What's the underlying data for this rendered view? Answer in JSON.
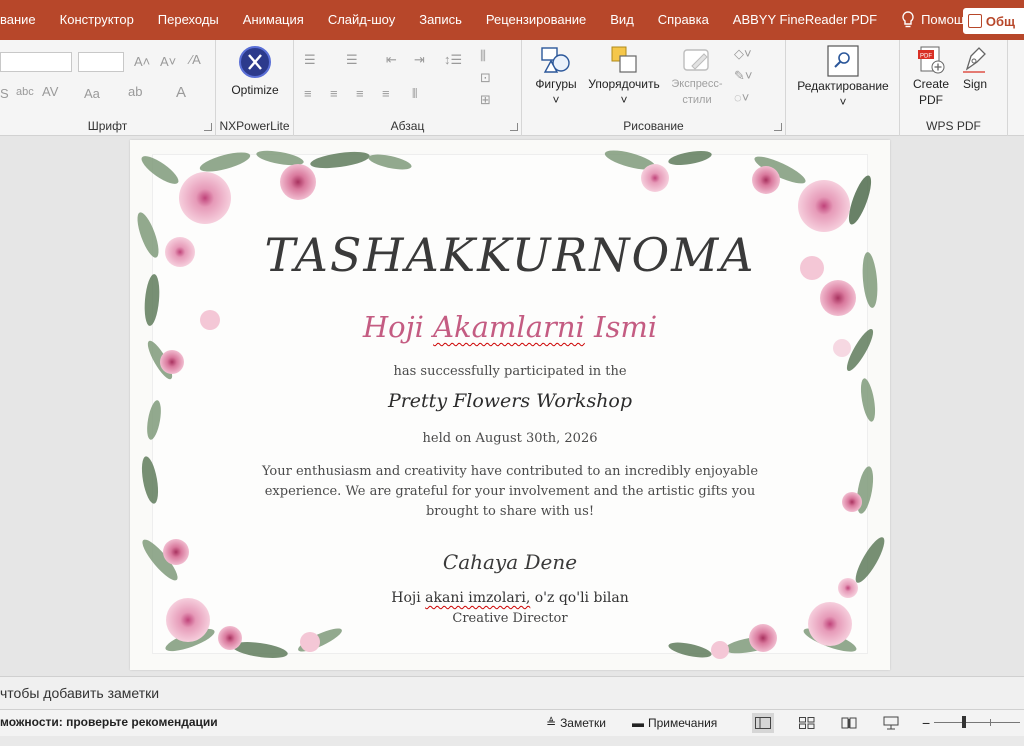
{
  "ribbon_tabs": [
    "вание",
    "Конструктор",
    "Переходы",
    "Анимация",
    "Слайд-шоу",
    "Запись",
    "Рецензирование",
    "Вид",
    "Справка",
    "ABBYY FineReader PDF"
  ],
  "help_label": "Помощ",
  "share_label": "Общ",
  "groups": {
    "font": "Шрифт",
    "nxpowerlite": "NXPowerLite",
    "paragraph": "Абзац",
    "drawing": "Рисование",
    "wps": "WPS PDF"
  },
  "buttons": {
    "optimize": "Optimize",
    "shapes": "Фигуры",
    "arrange": "Упорядочить",
    "express_styles": "Экспресс-стили",
    "editing": "Редактирование",
    "create_pdf": "Create PDF",
    "sign": "Sign"
  },
  "slide": {
    "title": "TASHAKKURNOMA",
    "name_word1": "Hoji",
    "name_word2": "Akamlarni",
    "name_word3": "Ismi",
    "participated": "has successfully participated in the",
    "workshop": "Pretty Flowers Workshop",
    "date": "held on August 30th, 2026",
    "body": "Your enthusiasm and creativity have contributed to an incredibly enjoyable experience. We are grateful for your involvement and the artistic gifts you brought to share with us!",
    "signature": "Cahaya Dene",
    "signer_a": "Hoji",
    "signer_b": "akani imzolari,",
    "signer_c": "o'z qo'li bilan",
    "role": "Creative Director"
  },
  "notes_placeholder": "чтобы добавить заметки",
  "status": {
    "left": "можности: проверьте рекомендации",
    "notes_btn": "Заметки",
    "comments_btn": "Примечания"
  },
  "colors": {
    "accent": "#b7472a",
    "name_pink": "#c45c82"
  }
}
